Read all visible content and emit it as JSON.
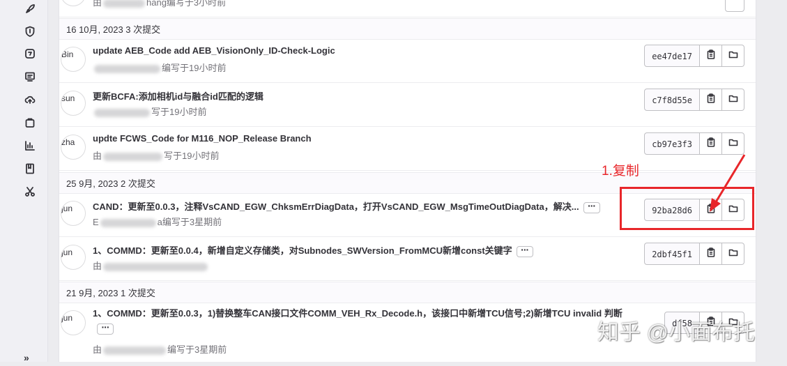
{
  "top_partial": {
    "meta_prefix": "由",
    "meta_suffix": "hang编写于3小时前"
  },
  "groups": [
    {
      "header": "16 10月, 2023 3 次提交",
      "commits": [
        {
          "avatar_alt": "Bin",
          "title": "update AEB_Code add AEB_VisionOnly_ID-Check-Logic",
          "meta_prefix": "",
          "meta_suffix": "编写于19小时前",
          "sha": "ee47de17",
          "ellipsis": false
        },
        {
          "avatar_alt": "sun",
          "title": "更新BCFA:添加相机id与融合id匹配的逻辑",
          "meta_prefix": "",
          "meta_suffix": "写于19小时前",
          "sha": "c7f8d55e",
          "ellipsis": false
        },
        {
          "avatar_alt": "zha",
          "title": "updte FCWS_Code for M116_NOP_Release Branch",
          "meta_prefix": "由",
          "meta_suffix": "写于19小时前",
          "sha": "cb97e3f3",
          "ellipsis": false
        }
      ]
    },
    {
      "header": "25 9月, 2023 2 次提交",
      "commits": [
        {
          "avatar_alt": "jun",
          "title": "CAND：更新至0.0.3，注释VsCAND_EGW_ChksmErrDiagData，打开VsCAND_EGW_MsgTimeOutDiagData，解决...",
          "meta_prefix": "",
          "meta_suffix": "a编写于3星期前",
          "sha": "92ba28d6",
          "ellipsis": true
        },
        {
          "avatar_alt": "jun",
          "title": "1、COMMD：更新至0.0.4，新增自定义存储类，对Subnodes_SWVersion_FromMCU新增const关键字",
          "meta_prefix": "由",
          "meta_suffix": "",
          "sha": "2dbf45f1",
          "ellipsis": true
        }
      ]
    },
    {
      "header": "21 9月, 2023 1 次提交",
      "commits": [
        {
          "avatar_alt": "jun",
          "title": "1、COMMD：更新至0.0.3，1)替换整车CAN接口文件COMM_VEH_Rx_Decode.h，该接口中新增TCU信号;2)新增TCU invalid 判断",
          "meta_prefix": "由",
          "meta_suffix": "编写于3星期前",
          "sha": "df58",
          "ellipsis": true
        }
      ]
    }
  ],
  "annotation": {
    "label": "1.复制",
    "color": "#e8262a"
  },
  "watermark": "知乎 @小面布托",
  "nav_icons": [
    "rocket-icon",
    "shield-icon",
    "deploy-icon",
    "monitor-icon",
    "cloud-upload-icon",
    "package-icon",
    "analytics-icon",
    "wiki-icon",
    "snippets-scissors-icon"
  ],
  "colors": {
    "accent_red": "#e8262a",
    "text": "#333238",
    "muted": "#737278"
  }
}
